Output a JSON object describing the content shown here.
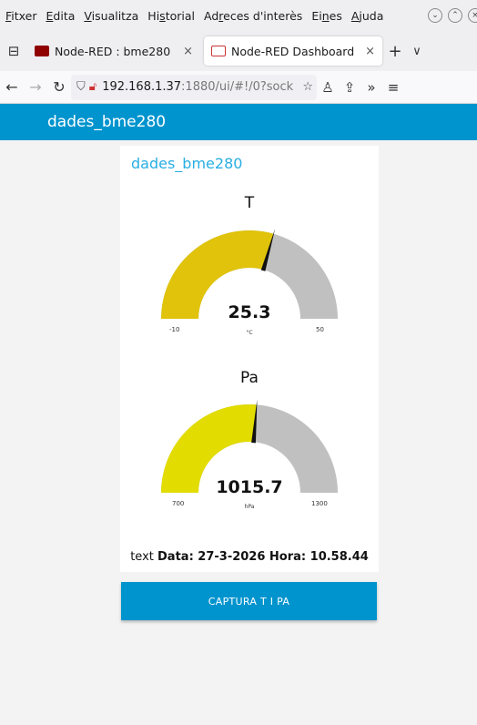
{
  "menu": {
    "items": [
      {
        "pre": "",
        "u": "F",
        "post": "itxer"
      },
      {
        "pre": "",
        "u": "E",
        "post": "dita"
      },
      {
        "pre": "",
        "u": "V",
        "post": "isualitza"
      },
      {
        "pre": "Hi",
        "u": "s",
        "post": "torial"
      },
      {
        "pre": "Ad",
        "u": "r",
        "post": "eces d'interès"
      },
      {
        "pre": "Ei",
        "u": "n",
        "post": "es"
      },
      {
        "pre": "",
        "u": "A",
        "post": "juda"
      }
    ]
  },
  "tabs": {
    "inactive_title": "Node-RED : bme280",
    "active_title": "Node-RED Dashboard",
    "close_glyph": "×",
    "new_tab_glyph": "+",
    "more_glyph": "∨"
  },
  "address": {
    "host": "192.168.1.37",
    "path": ":1880/ui/#!/0?sock"
  },
  "dashboard": {
    "header_title": "dades_bme280",
    "group_title": "dades_bme280",
    "gauges": [
      {
        "title": "T",
        "value": "25.3",
        "unit": "°C",
        "min": "-10",
        "max": "50",
        "fraction": 0.5883,
        "color": "#e0c30a"
      },
      {
        "title": "Pa",
        "value": "1015.7",
        "unit": "hPa",
        "min": "700",
        "max": "1300",
        "fraction": 0.5262,
        "color": "#e2dc00"
      }
    ],
    "text_label": "text",
    "text_value": "Data: 27-3-2026  Hora: 10.58.44",
    "button_label": "CAPTURA T I PA"
  },
  "colors": {
    "accent": "#0094ce",
    "group_title": "#29aee4",
    "gauge_track": "#c0c0c0"
  }
}
